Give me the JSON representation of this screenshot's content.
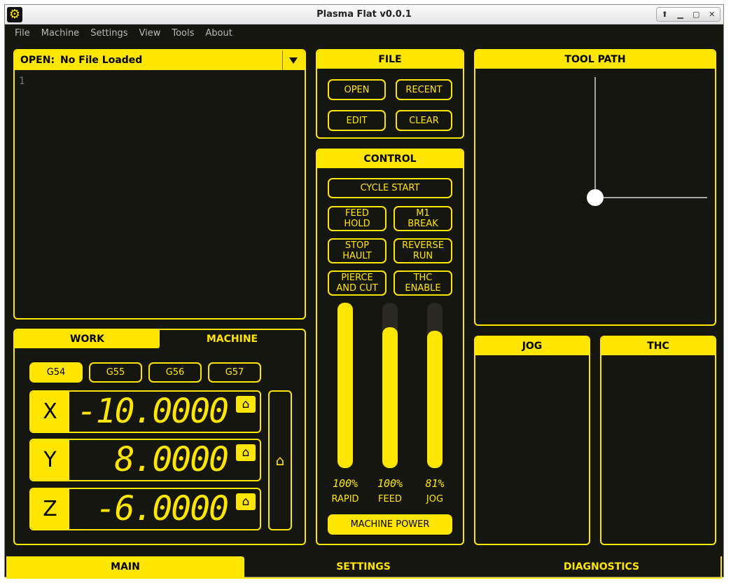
{
  "window": {
    "title": "Plasma Flat v0.0.1",
    "app_icon": "gear-icon",
    "controls": [
      "up-arrow-icon",
      "minimize-icon",
      "maximize-icon",
      "close-icon"
    ]
  },
  "menu": [
    "File",
    "Machine",
    "Settings",
    "View",
    "Tools",
    "About"
  ],
  "editor": {
    "open_label": "OPEN:",
    "file_name": "No File Loaded",
    "line_number": "1"
  },
  "file_panel": {
    "title": "FILE",
    "buttons": {
      "open": "OPEN",
      "recent": "RECENT",
      "edit": "EDIT",
      "clear": "CLEAR"
    }
  },
  "control_panel": {
    "title": "CONTROL",
    "cycle_start": "CYCLE START",
    "feed_hold": [
      "FEED",
      "HOLD"
    ],
    "m1_break": [
      "M1",
      "BREAK"
    ],
    "stop_hault": [
      "STOP",
      "HAULT"
    ],
    "reverse_run": [
      "REVERSE",
      "RUN"
    ],
    "pierce_and_cut": [
      "PIERCE",
      "AND CUT"
    ],
    "thc_enable": [
      "THC",
      "ENABLE"
    ],
    "sliders": [
      {
        "label": "RAPID",
        "value_text": "100%",
        "level": 1.0
      },
      {
        "label": "FEED",
        "value_text": "100%",
        "level": 0.85
      },
      {
        "label": "JOG",
        "value_text": "81%",
        "level": 0.83
      }
    ],
    "machine_power": "MACHINE POWER"
  },
  "toolpath": {
    "title": "TOOL PATH"
  },
  "jog": {
    "title": "JOG"
  },
  "thc": {
    "title": "THC"
  },
  "dro": {
    "tabs": {
      "work": "WORK",
      "machine": "MACHINE"
    },
    "active_tab": "WORK",
    "offsets": [
      "G54",
      "G55",
      "G56",
      "G57"
    ],
    "active_offset": "G54",
    "axes": [
      {
        "axis": "X",
        "value": "-10.0000"
      },
      {
        "axis": "Y",
        "value": "8.0000"
      },
      {
        "axis": "Z",
        "value": "-6.0000"
      }
    ],
    "home_icon": "home-icon",
    "home_all_icon": "home-icon"
  },
  "bottom_tabs": [
    "MAIN",
    "SETTINGS",
    "DIAGNOSTICS"
  ],
  "active_bottom_tab": "MAIN",
  "colors": {
    "accent": "#ffe600",
    "background": "#161610"
  }
}
